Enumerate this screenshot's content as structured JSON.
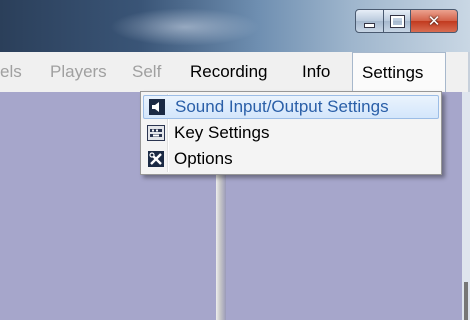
{
  "window": {
    "controls": {
      "minimize": "minimize-button",
      "maximize": "maximize-button",
      "close": "close-button"
    }
  },
  "menubar": {
    "items": [
      {
        "label": "els",
        "enabled": false
      },
      {
        "label": "Players",
        "enabled": false
      },
      {
        "label": "Self",
        "enabled": false
      },
      {
        "label": "Recording",
        "enabled": true
      },
      {
        "label": "Info",
        "enabled": true
      },
      {
        "label": "Settings",
        "enabled": true,
        "open": true
      }
    ]
  },
  "settings_menu": {
    "items": [
      {
        "label": "Sound Input/Output Settings",
        "icon": "speaker-icon",
        "highlighted": true
      },
      {
        "label": "Key Settings",
        "icon": "keyboard-icon",
        "highlighted": false
      },
      {
        "label": "Options",
        "icon": "tools-icon",
        "highlighted": false
      }
    ]
  },
  "colors": {
    "highlight_text": "#2a5fa8",
    "pane_background": "#a6a6cb",
    "disabled_text": "#a0a0a0"
  }
}
